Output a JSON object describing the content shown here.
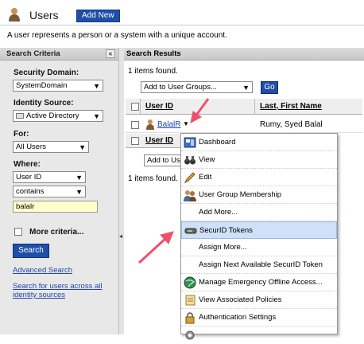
{
  "header": {
    "title": "Users",
    "add_new": "Add New",
    "description": "A user represents a person or a system with a unique account."
  },
  "search_criteria": {
    "title": "Search Criteria",
    "collapse": "«",
    "security_domain_label": "Security Domain:",
    "security_domain_value": "SystemDomain",
    "identity_source_label": "Identity Source:",
    "identity_source_value": "Active Directory",
    "for_label": "For:",
    "for_value": "All Users",
    "where_label": "Where:",
    "where_field": "User ID",
    "where_op": "contains",
    "where_value": "balalr",
    "more_criteria": "More criteria...",
    "search_button": "Search",
    "advanced_search": "Advanced Search",
    "search_all": "Search for users across all identity sources"
  },
  "results": {
    "title": "Search Results",
    "count_text": "1 items found.",
    "group_select": "Add to User Groups...",
    "go": "Go",
    "col_userid": "User ID",
    "col_name": "Last, First Name",
    "row_userid": "BalalR",
    "row_name": "Rumy, Syed Balal",
    "add_to_partial": "Add to Us",
    "count_text_2": "1 items found."
  },
  "menu": {
    "items": [
      {
        "label": "Dashboard",
        "icon": "dashboard-icon"
      },
      {
        "label": "View",
        "icon": "binoculars-icon"
      },
      {
        "label": "Edit",
        "icon": "pencil-icon"
      },
      {
        "label": "User Group Membership",
        "icon": "group-icon"
      },
      {
        "label": "Add More...",
        "icon": ""
      },
      {
        "label": "SecurID Tokens",
        "icon": "token-icon"
      },
      {
        "label": "Assign More...",
        "icon": ""
      },
      {
        "label": "Assign Next Available SecurID Token",
        "icon": ""
      },
      {
        "label": "Manage Emergency Offline Access...",
        "icon": "globe-icon"
      },
      {
        "label": "View Associated Policies",
        "icon": "scroll-icon"
      },
      {
        "label": "Authentication Settings",
        "icon": "lock-icon"
      },
      {
        "label": "",
        "icon": "gear-icon"
      }
    ]
  },
  "colors": {
    "accent": "#1f4ea8",
    "highlight": "#cfe0f7",
    "arrow": "#f0506e"
  }
}
